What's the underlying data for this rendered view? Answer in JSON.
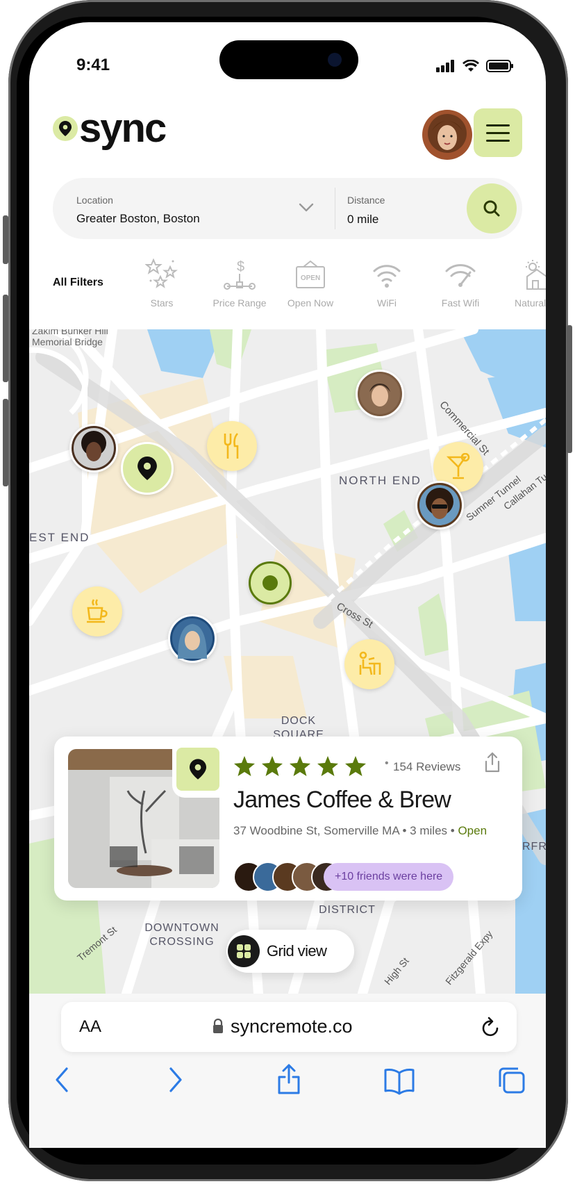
{
  "status": {
    "time": "9:41"
  },
  "app": {
    "name": "sync"
  },
  "search": {
    "location_label": "Location",
    "location_value": "Greater Boston, Boston",
    "distance_label": "Distance",
    "distance_value": "0 mile"
  },
  "filters": {
    "all_label": "All Filters",
    "items": [
      {
        "label": "Stars",
        "icon": "stars-icon"
      },
      {
        "label": "Price Range",
        "icon": "price-range-icon"
      },
      {
        "label": "Open Now",
        "icon": "open-sign-icon"
      },
      {
        "label": "WiFi",
        "icon": "wifi-icon"
      },
      {
        "label": "Fast Wifi",
        "icon": "fast-wifi-icon"
      },
      {
        "label": "Natural Li",
        "icon": "natural-light-icon"
      }
    ]
  },
  "map": {
    "labels": {
      "bridge": "Zakim Bunker Hill Memorial Bridge",
      "commercial": "Commercial St",
      "north_end": "NORTH END",
      "tunnel": "Sumner Tunnel",
      "callahan": "Callahan Tu",
      "west_end": "EST END",
      "cross": "Cross St",
      "dock": "DOCK SQUARE",
      "financial": "FINANCIAL DISTRICT",
      "downtown": "DOWNTOWN CROSSING",
      "tremont": "Tremont St",
      "high": "High St",
      "expy": "Fitzgerald Expy",
      "edge_right": "RFRO"
    }
  },
  "card": {
    "title": "James Coffee & Brew",
    "rating": 5,
    "reviews": "154 Reviews",
    "address": "37 Woodbine St, Somerville MA",
    "distance": "3 miles",
    "status": "Open",
    "friends": "+10 friends were here"
  },
  "grid_view": {
    "label": "Grid view"
  },
  "browser": {
    "text_size": "AA",
    "url": "syncremote.co"
  },
  "colors": {
    "accent": "#dbeaa4",
    "accent_dark": "#5a7a0c",
    "pin_yellow": "#fdeca8",
    "friends_purple": "#d9c2f4"
  }
}
